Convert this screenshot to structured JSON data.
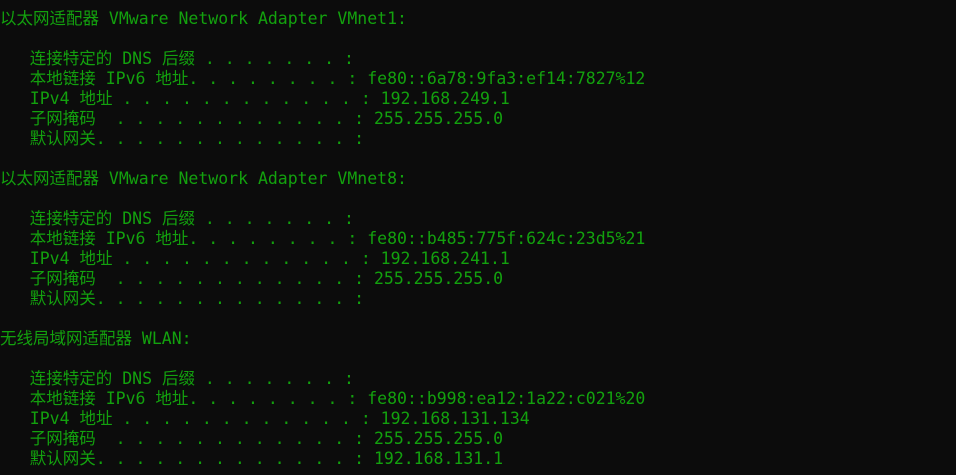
{
  "terminal": {
    "text_color": "#13a10e",
    "background_color": "#0c0c0c",
    "lines": [
      "以太网适配器 VMware Network Adapter VMnet1:",
      "",
      "   连接特定的 DNS 后缀 . . . . . . . :",
      "   本地链接 IPv6 地址. . . . . . . . : fe80::6a78:9fa3:ef14:7827%12",
      "   IPv4 地址 . . . . . . . . . . . . : 192.168.249.1",
      "   子网掩码  . . . . . . . . . . . . : 255.255.255.0",
      "   默认网关. . . . . . . . . . . . . :",
      "",
      "以太网适配器 VMware Network Adapter VMnet8:",
      "",
      "   连接特定的 DNS 后缀 . . . . . . . :",
      "   本地链接 IPv6 地址. . . . . . . . : fe80::b485:775f:624c:23d5%21",
      "   IPv4 地址 . . . . . . . . . . . . : 192.168.241.1",
      "   子网掩码  . . . . . . . . . . . . : 255.255.255.0",
      "   默认网关. . . . . . . . . . . . . :",
      "",
      "无线局域网适配器 WLAN:",
      "",
      "   连接特定的 DNS 后缀 . . . . . . . :",
      "   本地链接 IPv6 地址. . . . . . . . : fe80::b998:ea12:1a22:c021%20",
      "   IPv4 地址 . . . . . . . . . . . . : 192.168.131.134",
      "   子网掩码  . . . . . . . . . . . . : 255.255.255.0",
      "   默认网关. . . . . . . . . . . . . : 192.168.131.1"
    ]
  }
}
